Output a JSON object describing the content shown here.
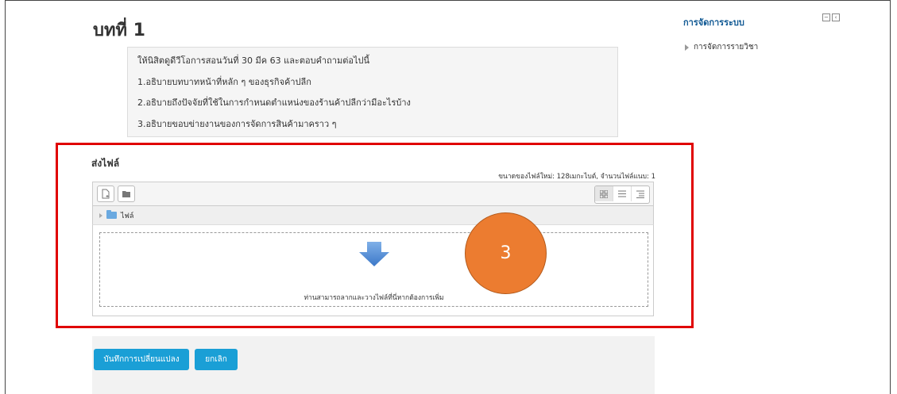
{
  "page": {
    "title": "บทที่ 1"
  },
  "intro": {
    "lines": [
      "ให้นิสิตดูดีวีโอการสอนวันที่ 30 มีค 63 และตอบคำถามต่อไปนี้",
      "1.อธิบายบทบาทหน้าที่หลัก ๆ ของธุรกิจค้าปลีก",
      "2.อธิบายถึงปัจจัยที่ใช้ในการกำหนดตำแหน่งของร้านค้าปลีกว่ามีอะไรบ้าง",
      "3.อธิบายขอบข่ายงานของการจัดการสินค้ามาคราว ๆ"
    ]
  },
  "admin_block": {
    "title": "การจัดการระบบ",
    "items": [
      {
        "label": "การจัดการรายวิชา"
      }
    ]
  },
  "submission": {
    "label": "ส่งไฟล์",
    "limits": "ขนาดของไฟล์ใหม่: 128เมกะไบต์, จำนวนไฟล์แนบ: 1",
    "folder_label": "ไฟล์",
    "drop_text": "ท่านสามารถลากและวางไฟล์ที่นี่หากต้องการเพิ่ม"
  },
  "annotation": {
    "step_number": "3",
    "color": "#ec7c30",
    "highlight_color": "#e00000"
  },
  "actions": {
    "save_label": "บันทึกการเปลี่ยนแปลง",
    "cancel_label": "ยกเลิก"
  },
  "colors": {
    "primary_button": "#1a9fd6",
    "block_title": "#0f5893"
  }
}
